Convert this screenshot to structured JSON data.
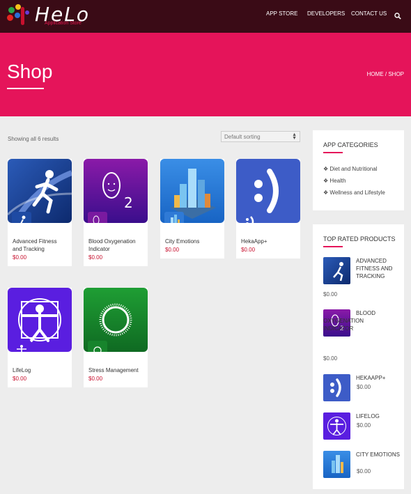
{
  "header": {
    "logo_word": "HeLo",
    "logo_sub": "Application Store",
    "nav": [
      "APP STORE",
      "DEVELOPERS",
      "CONTACT US"
    ],
    "search_icon": "search-icon"
  },
  "hero": {
    "title": "Shop",
    "breadcrumb": "HOME / SHOP",
    "bg_color": "#e5145a"
  },
  "toolbar": {
    "results": "Showing all 6 results",
    "sort_selected": "Default sorting"
  },
  "products": [
    {
      "name": "Advanced Fitness and Tracking",
      "price": "$0.00",
      "icon": "runner-icon"
    },
    {
      "name": "Blood Oxygenation Indicator",
      "price": "$0.00",
      "icon": "o2-icon"
    },
    {
      "name": "City Emotions",
      "price": "$0.00",
      "icon": "city-icon"
    },
    {
      "name": "HekaApp+",
      "price": "$0.00",
      "icon": "heka-face-icon"
    },
    {
      "name": "LifeLog",
      "price": "$0.00",
      "icon": "vitruvian-icon"
    },
    {
      "name": "Stress Management",
      "price": "$0.00",
      "icon": "ring-icon"
    }
  ],
  "categories": {
    "title": "APP CATEGORIES",
    "items": [
      "Diet and Nutritional",
      "Health",
      "Wellness and Lifestyle"
    ]
  },
  "top_rated": {
    "title": "TOP RATED PRODUCTS",
    "items": [
      {
        "name": "ADVANCED FITNESS AND TRACKING",
        "price": "$0.00"
      },
      {
        "name": "BLOOD OXYGENATION INDICATOR",
        "price": "$0.00"
      },
      {
        "name": "HEKAAPP+",
        "price": "$0.00"
      },
      {
        "name": "LIFELOG",
        "price": "$0.00"
      },
      {
        "name": "CITY EMOTIONS",
        "price": "$0.00"
      }
    ]
  },
  "colors": {
    "accent": "#e5145a",
    "header": "#3a0b16",
    "price": "#c8102e"
  }
}
